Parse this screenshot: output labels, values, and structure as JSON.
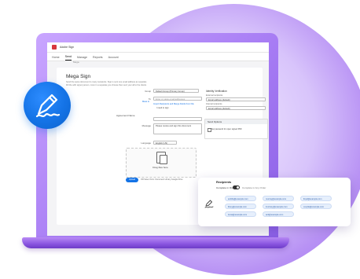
{
  "window": {
    "title": "Adobe Sign"
  },
  "nav": {
    "tabs": [
      {
        "label": "Home"
      },
      {
        "label": "Send"
      },
      {
        "label": "Manage"
      },
      {
        "label": "Reports"
      },
      {
        "label": "Account"
      }
    ],
    "send_sub": "Mega"
  },
  "form": {
    "title": "Mega Sign",
    "description_line1": "Send the same document to many recipients. Sign is sent one email address as separate",
    "description_line2": "Fill the with signer person, more in a separate you choose then sent your all to the clients",
    "to_label": "To",
    "to_link": "Mass to",
    "group_label": "Group",
    "group_value": "Default Group (Primary Group)",
    "to_placeholder": "Enter or paste email addresses",
    "import_link": "Import Recipients and Merge Fields from File",
    "need_sign": "I need to sign",
    "agreement_label": "Agreement Name",
    "message_label": "Message",
    "message_value": "Please review and sign this document",
    "language_label": "Language",
    "language_value": "English (US)",
    "drop_text": "Drag files here",
    "upload_label": "Upload",
    "upload_sources": "OR Select from: Document Library  Google Drive"
  },
  "right_panel": {
    "title": "Identity Verification",
    "external_label": "External recipients",
    "external_value": "Email address (default)",
    "internal_label": "Internal recipients",
    "internal_value": "Email address (default)",
    "send_options_title": "Send Options",
    "password_option": "Set password for open signed PDF"
  },
  "recipients_card": {
    "title": "Recipients",
    "complete_in_order": "Complete in Order",
    "complete_any_order": "Complete in Any Order",
    "emails": [
      "ambliq@example.com",
      "murray@example.com",
      "lloyd@example.com",
      "lliney@example.com",
      "lmoriscy@example.com",
      "cucylle@example.com",
      "lucas@example.com",
      "anti@example.com"
    ]
  },
  "colors": {
    "accent": "#1473e6",
    "brand_purple": "#9b6ded",
    "adobe_red": "#d7373f"
  },
  "icons": {
    "badge": "signature-pen-icon",
    "card": "signature-pen-icon"
  }
}
